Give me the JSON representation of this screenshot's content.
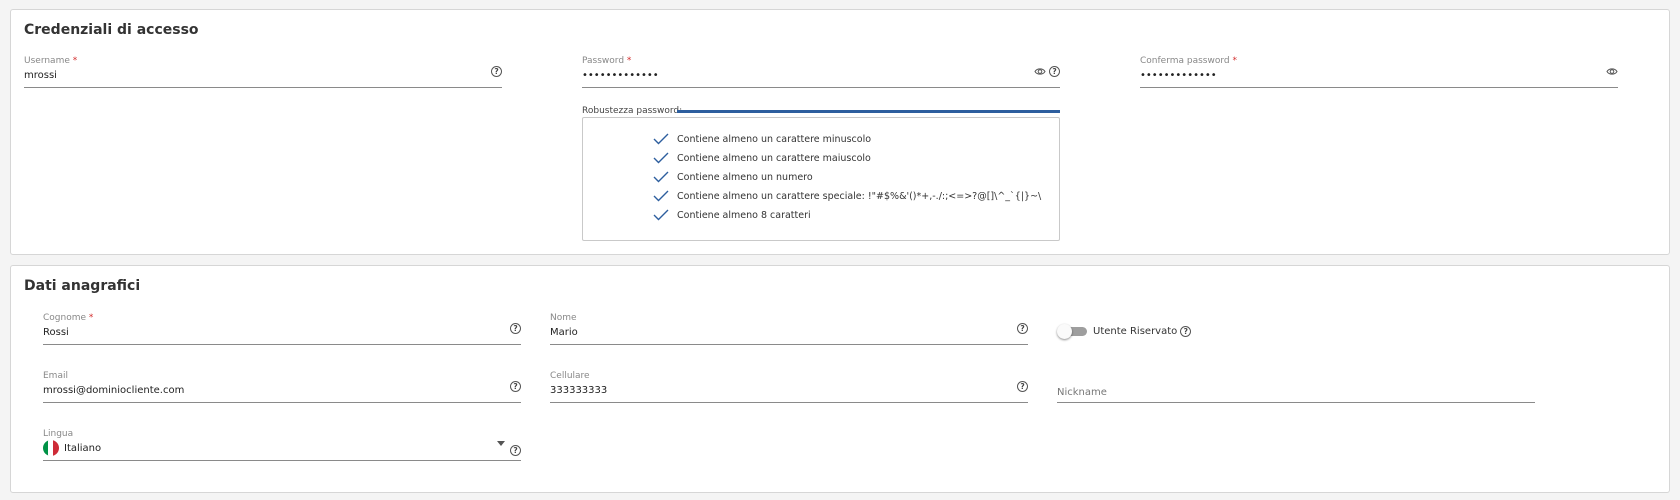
{
  "credentials": {
    "title": "Credenziali di accesso",
    "username": {
      "label": "Username",
      "required_mark": "*",
      "value": "mrossi"
    },
    "password": {
      "label": "Password",
      "required_mark": "*",
      "value": "•••••••••••••"
    },
    "confirm_password": {
      "label": "Conferma password",
      "required_mark": "*",
      "value": "•••••••••••••"
    },
    "strength": {
      "label": "Robustezza password:",
      "level_percent": 100,
      "color": "#2d5e9e"
    },
    "rules": [
      "Contiene almeno un carattere minuscolo",
      "Contiene almeno un carattere maiuscolo",
      "Contiene almeno un numero",
      "Contiene almeno un carattere speciale: !\"#$%&'()*+,-./:;<=>?@[]\\^_`{|}~\\",
      "Contiene almeno 8 caratteri"
    ]
  },
  "personal": {
    "title": "Dati anagrafici",
    "surname": {
      "label": "Cognome",
      "required_mark": "*",
      "value": "Rossi"
    },
    "name": {
      "label": "Nome",
      "value": "Mario"
    },
    "reserved_user": {
      "label": "Utente Riservato",
      "checked": false
    },
    "email": {
      "label": "Email",
      "value": "mrossi@dominiocliente.com"
    },
    "mobile": {
      "label": "Cellulare",
      "value": "333333333"
    },
    "nickname": {
      "placeholder": "Nickname"
    },
    "language": {
      "label": "Lingua",
      "value": "Italiano"
    }
  },
  "icons": {
    "help": "?",
    "eye": "eye-icon",
    "check": "check-icon",
    "flag": "italy-flag-icon"
  },
  "colors": {
    "required": "#d32f2f",
    "accent": "#2d5e9e",
    "flag_green": "#009246",
    "flag_white": "#ffffff",
    "flag_red": "#ce2b37"
  }
}
